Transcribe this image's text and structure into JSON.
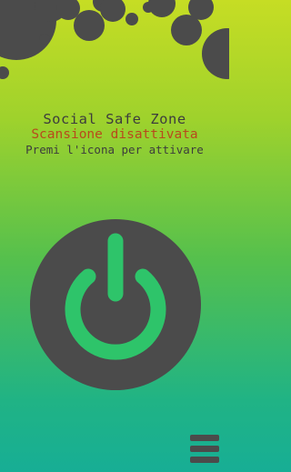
{
  "header": {
    "title": "Social Safe Zone",
    "status": "Scansione disattivata",
    "hint": "Premi l'icona per attivare"
  },
  "power_button": {
    "icon": "power-icon",
    "state": "off"
  },
  "menu": {
    "icon": "hamburger-menu-icon"
  },
  "colors": {
    "dark": "#4b4b4b",
    "accent_green": "#2ec46a",
    "status_orange": "#b84a1c",
    "gradient_top": "#c6dd24",
    "gradient_bottom": "#17ae95"
  }
}
